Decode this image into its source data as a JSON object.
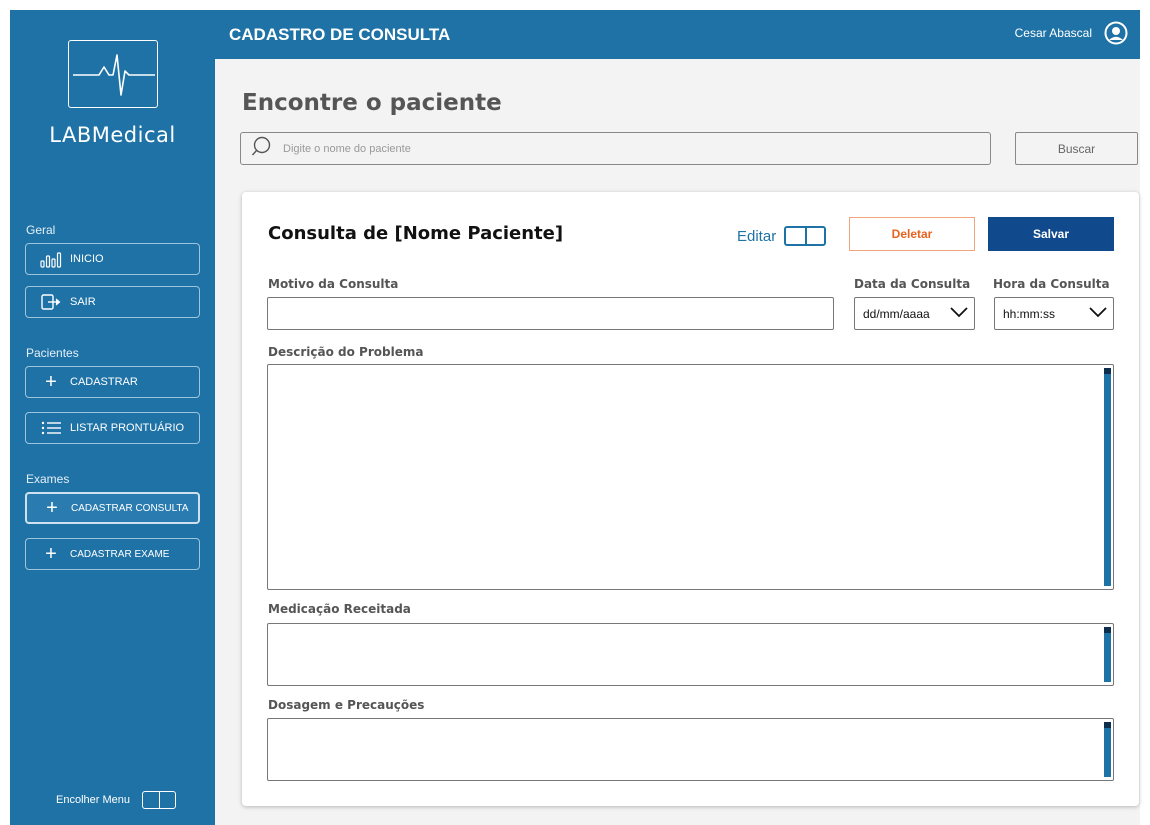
{
  "app": {
    "name": "LABMedical"
  },
  "topbar": {
    "title": "CADASTRO DE CONSULTA",
    "user_name": "Cesar Abascal",
    "user_icon": "user-circle-icon"
  },
  "sidebar": {
    "section_geral": "Geral",
    "inicio": "INICIO",
    "sair": "SAIR",
    "section_pacientes": "Pacientes",
    "cadastrar": "CADASTRAR",
    "listar": "LISTAR PRONTUÁRIO",
    "section_exames": "Exames",
    "cadastrar_consulta": "CADASTRAR CONSULTA",
    "cadastrar_exame": "CADASTRAR EXAME",
    "collapse_label": "Encolher Menu",
    "active_item": "CADASTRAR CONSULTA"
  },
  "search": {
    "title": "Encontre o paciente",
    "placeholder": "Digite o nome do paciente",
    "button": "Buscar"
  },
  "form": {
    "title": "Consulta de [Nome Paciente]",
    "edit_label": "Editar",
    "delete_label": "Deletar",
    "save_label": "Salvar",
    "motivo_label": "Motivo da Consulta",
    "motivo_value": "",
    "data_label": "Data da Consulta",
    "data_value": "dd/mm/aaaa",
    "hora_label": "Hora da Consulta",
    "hora_value": "hh:mm:ss",
    "descricao_label": "Descrição do Problema",
    "medicacao_label": "Medicação Receitada",
    "dosagem_label": "Dosagem e Precauções"
  },
  "colors": {
    "primary": "#1f72a6",
    "save": "#104a8c",
    "delete": "#e8631f",
    "background": "#f3f3f3"
  }
}
